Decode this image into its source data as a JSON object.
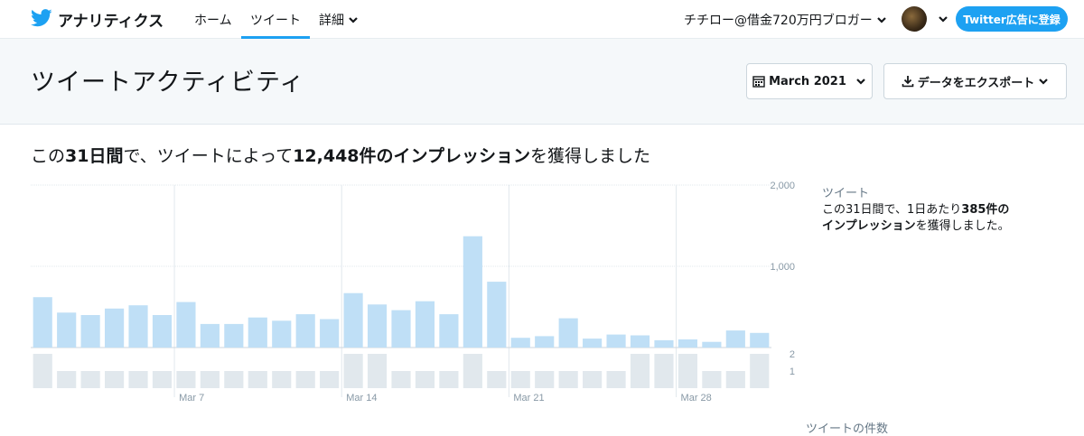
{
  "topbar": {
    "brand": "アナリティクス",
    "nav": [
      {
        "label": "ホーム"
      },
      {
        "label": "ツイート"
      },
      {
        "label": "詳細"
      }
    ],
    "account_name": "チチロー@借金720万円ブロガー",
    "ad_button": "Twitter広告に登録"
  },
  "hero": {
    "title": "ツイートアクティビティ",
    "date_button": "March 2021",
    "export_button": "データをエクスポート"
  },
  "summary": {
    "prefix": "この",
    "days": "31日間",
    "middle": "で、ツイートによって",
    "impressions": "12,448件のインプレッション",
    "suffix": "を獲得しました"
  },
  "side": {
    "title": "ツイート",
    "line_prefix": "この31日間で、1日あたり",
    "per_day": "385件のインプレッション",
    "line_suffix": "を獲得しました。"
  },
  "footer": {
    "cut_text": "ツイートの件数"
  },
  "colors": {
    "accent": "#1da1f2",
    "bar": "#bfdff6",
    "tweet_bar": "#e1e8ed"
  },
  "chart_data": {
    "type": "bar",
    "title": "",
    "xlabel": "",
    "ylabel": "",
    "ylim": [
      0,
      2000
    ],
    "y_ticks": [
      "2,000",
      "1,000"
    ],
    "x_ticks": [
      "Mar 7",
      "Mar 14",
      "Mar 21",
      "Mar 28"
    ],
    "categories": [
      "Mar 1",
      "Mar 2",
      "Mar 3",
      "Mar 4",
      "Mar 5",
      "Mar 6",
      "Mar 7",
      "Mar 8",
      "Mar 9",
      "Mar 10",
      "Mar 11",
      "Mar 12",
      "Mar 13",
      "Mar 14",
      "Mar 15",
      "Mar 16",
      "Mar 17",
      "Mar 18",
      "Mar 19",
      "Mar 20",
      "Mar 21",
      "Mar 22",
      "Mar 23",
      "Mar 24",
      "Mar 25",
      "Mar 26",
      "Mar 27",
      "Mar 28",
      "Mar 29",
      "Mar 30",
      "Mar 31"
    ],
    "series": [
      {
        "values": [
          620,
          430,
          400,
          480,
          520,
          400,
          560,
          290,
          290,
          370,
          330,
          410,
          350,
          670,
          530,
          460,
          570,
          410,
          1370,
          810,
          120,
          140,
          360,
          110,
          160,
          150,
          90,
          100,
          70,
          210,
          180
        ]
      }
    ],
    "tweet_counts": {
      "ylim": [
        0,
        2
      ],
      "y_ticks": [
        "2",
        "1"
      ],
      "values": [
        2,
        1,
        1,
        1,
        1,
        1,
        1,
        1,
        1,
        1,
        1,
        1,
        1,
        2,
        2,
        1,
        1,
        1,
        2,
        1,
        1,
        1,
        1,
        1,
        1,
        2,
        2,
        2,
        1,
        1,
        2
      ]
    }
  }
}
